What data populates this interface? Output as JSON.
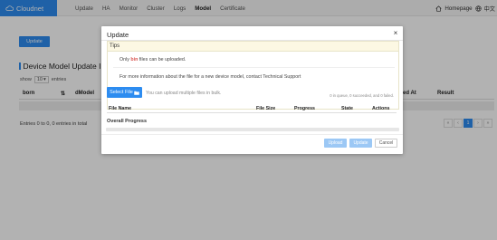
{
  "brand": {
    "name": "Cloudnet"
  },
  "nav": {
    "items": [
      {
        "label": "Update",
        "active": false
      },
      {
        "label": "HA",
        "active": false
      },
      {
        "label": "Monitor",
        "active": false
      },
      {
        "label": "Cluster",
        "active": false
      },
      {
        "label": "Logs",
        "active": false
      },
      {
        "label": "Model",
        "active": true
      },
      {
        "label": "Certificate",
        "active": false
      }
    ],
    "homepage": "Homepage",
    "language": "中文"
  },
  "page": {
    "update_button": "Update",
    "section_title": "Device Model Update Info",
    "show_label": "show",
    "page_size": "10",
    "entries_label": "entries",
    "columns": [
      "born",
      "dModel",
      "ed At",
      "Result"
    ],
    "entries_info": "Entries 0 to 0, 0 entries in total",
    "pager": [
      "«",
      "‹",
      "1",
      "›",
      "»"
    ]
  },
  "modal": {
    "title": "Update",
    "close": "×",
    "tips_title": "Tips",
    "tip1_pre": "Only ",
    "tip1_highlight": "bin",
    "tip1_post": " files can be uploaded.",
    "tip2": "For more information about the file for a new device model, contact Technical Support",
    "select_file": "Select File",
    "bulk_hint": "You can upload multiple files in bulk.",
    "queue_status": "0 in queue, 0 succeeded, and 0 failed.",
    "file_columns": [
      "File Name",
      "File Size",
      "Progress",
      "State",
      "Actions"
    ],
    "overall_progress": "Overall Progress",
    "overall_progress_value": 0,
    "buttons": {
      "upload": "Upload",
      "update": "Update",
      "cancel": "Cancel"
    }
  },
  "colors": {
    "accent": "#2d8cf0",
    "highlight": "#d9534f",
    "tips_bg": "#fcf8e3"
  }
}
